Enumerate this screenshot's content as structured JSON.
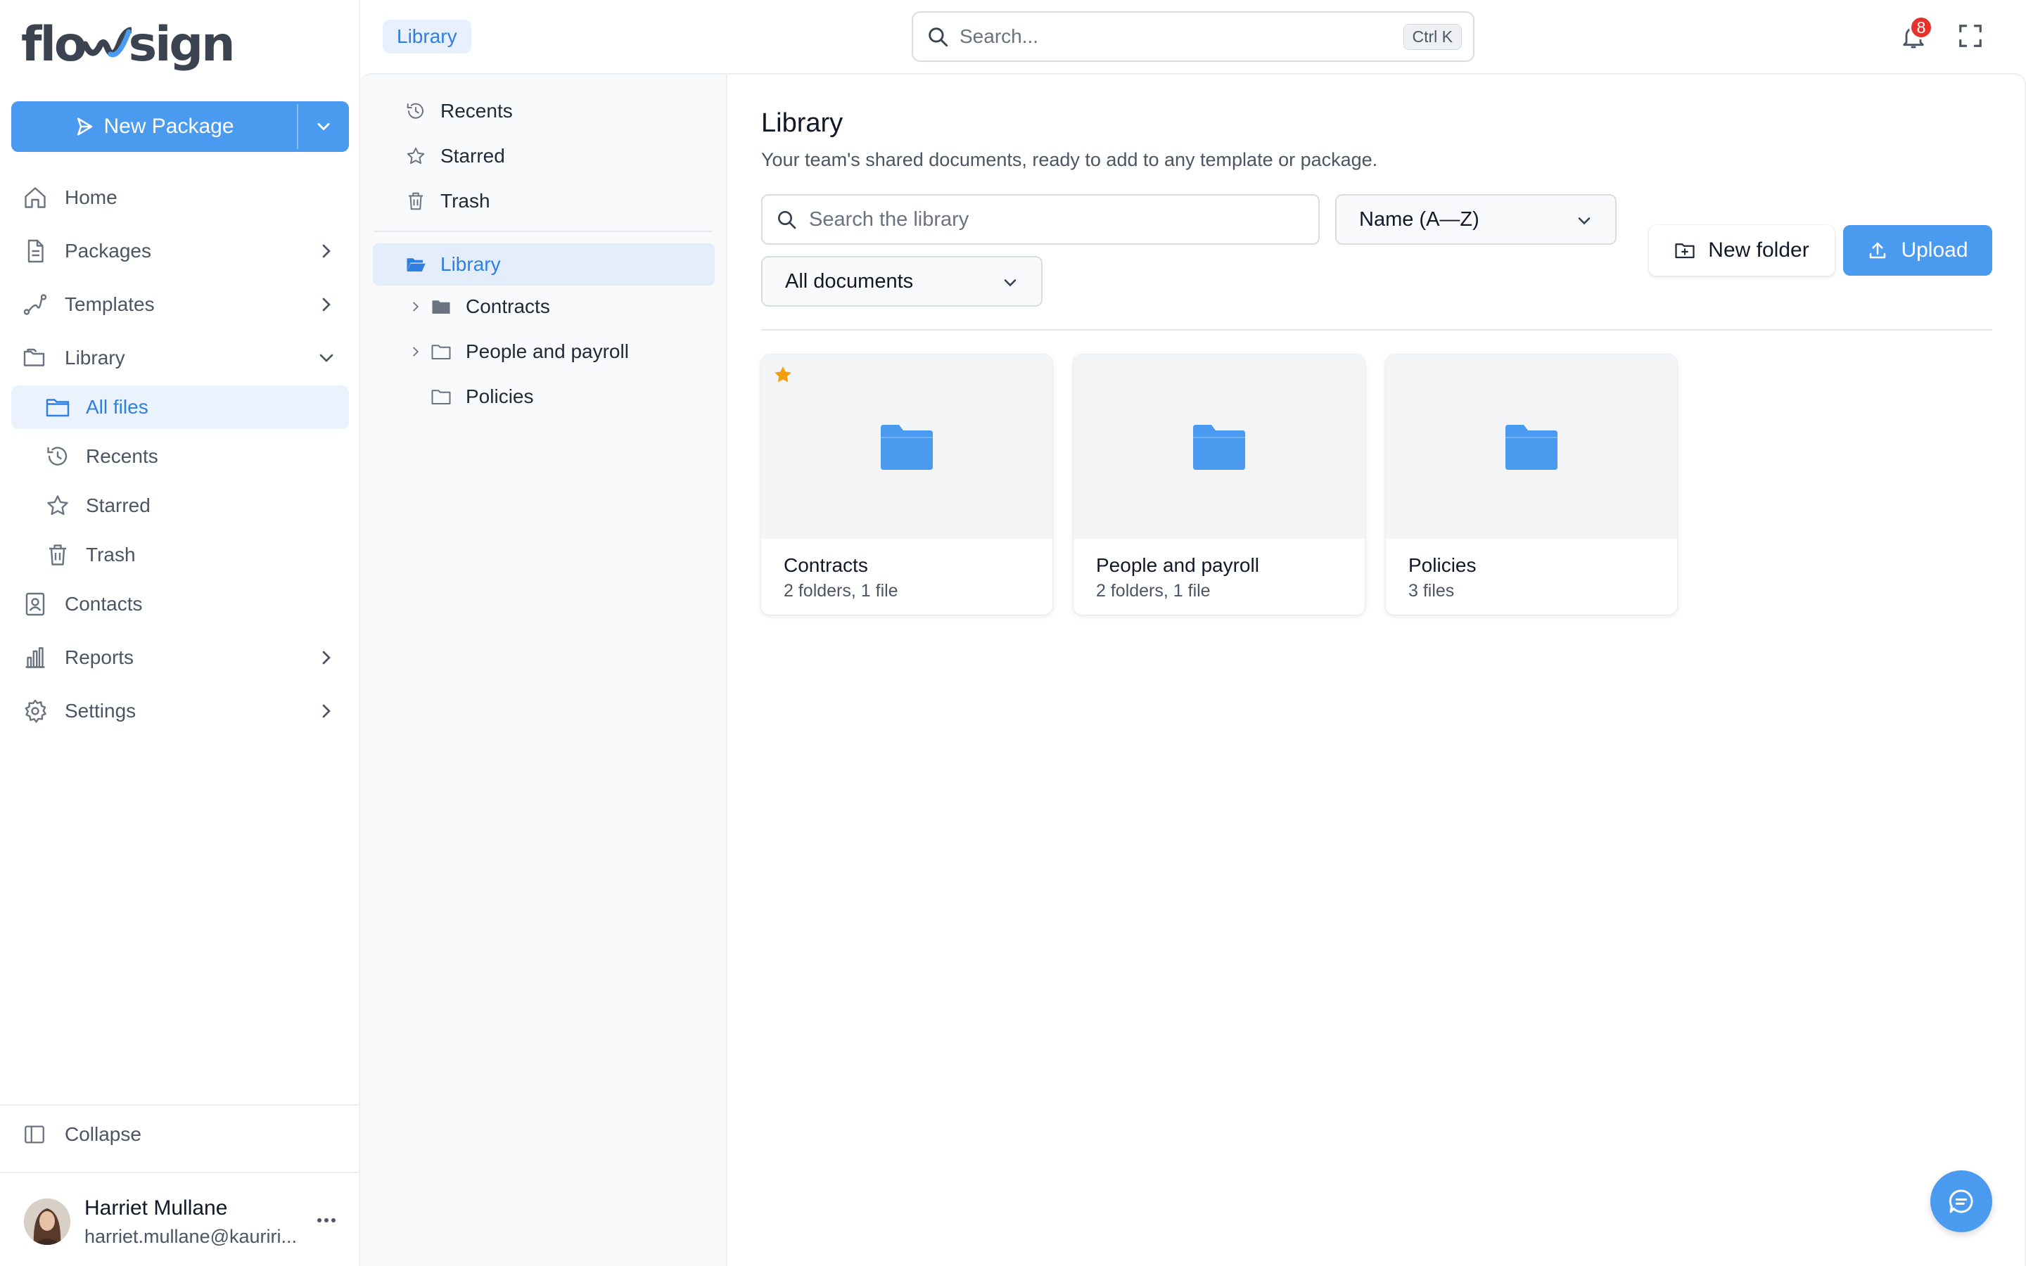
{
  "brand": {
    "logo_text_left": "flo",
    "logo_text_right": "sign",
    "accent": "#4a9af0"
  },
  "sidebar": {
    "new_package_label": "New Package",
    "items": [
      {
        "label": "Home",
        "icon": "home-icon"
      },
      {
        "label": "Packages",
        "icon": "document-icon"
      },
      {
        "label": "Templates",
        "icon": "route-icon"
      },
      {
        "label": "Library",
        "icon": "folders-icon"
      },
      {
        "label": "Contacts",
        "icon": "contact-card-icon"
      },
      {
        "label": "Reports",
        "icon": "bar-chart-icon"
      },
      {
        "label": "Settings",
        "icon": "gear-icon"
      }
    ],
    "library_sub": [
      {
        "label": "All files",
        "icon": "folder-icon",
        "active": true
      },
      {
        "label": "Recents",
        "icon": "history-icon"
      },
      {
        "label": "Starred",
        "icon": "star-icon"
      },
      {
        "label": "Trash",
        "icon": "trash-icon"
      }
    ],
    "collapse_label": "Collapse",
    "user": {
      "name": "Harriet Mullane",
      "email": "harriet.mullane@kauriri..."
    }
  },
  "topbar": {
    "breadcrumb": "Library",
    "search_placeholder": "Search...",
    "shortcut": "Ctrl K",
    "notification_count": "8"
  },
  "tree": {
    "quick": [
      {
        "label": "Recents",
        "icon": "history-icon"
      },
      {
        "label": "Starred",
        "icon": "star-icon"
      },
      {
        "label": "Trash",
        "icon": "trash-icon"
      }
    ],
    "root": "Library",
    "folders": [
      {
        "label": "Contracts",
        "expandable": true,
        "filled": true
      },
      {
        "label": "People and payroll",
        "expandable": true,
        "filled": false
      },
      {
        "label": "Policies",
        "expandable": false,
        "filled": false
      }
    ]
  },
  "main": {
    "title": "Library",
    "subtitle": "Your team's shared documents, ready to add to any template or package.",
    "search_placeholder": "Search the library",
    "sort_value": "Name (A—Z)",
    "filter_value": "All documents",
    "new_folder_label": "New folder",
    "upload_label": "Upload",
    "cards": [
      {
        "name": "Contracts",
        "meta": "2 folders, 1 file",
        "starred": true
      },
      {
        "name": "People and payroll",
        "meta": "2 folders, 1 file",
        "starred": false
      },
      {
        "name": "Policies",
        "meta": "3 files",
        "starred": false
      }
    ]
  }
}
